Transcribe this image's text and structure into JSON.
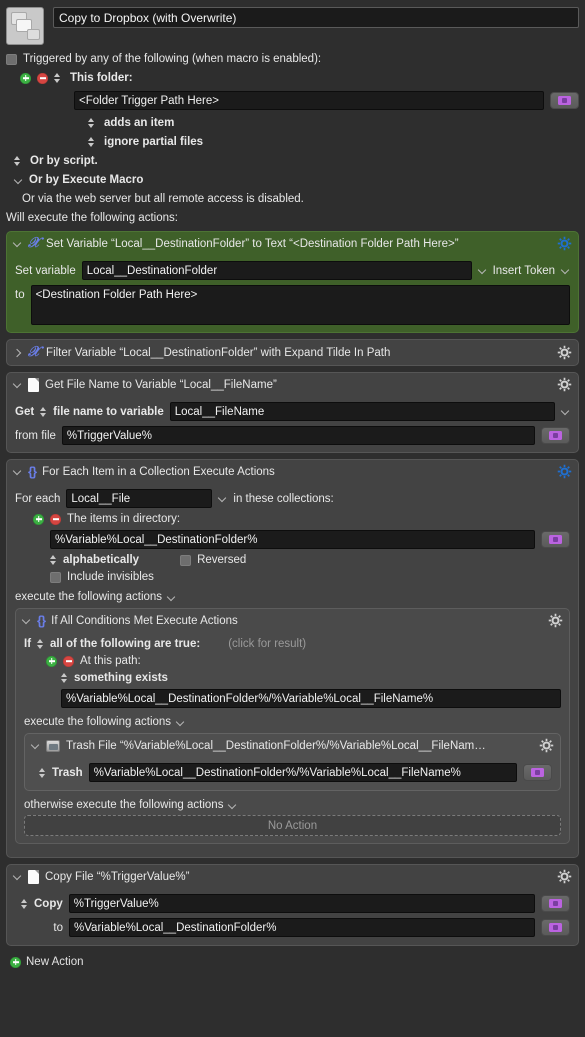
{
  "header": {
    "macro_icon": "copy-documents-icon",
    "macro_title": "Copy to Dropbox (with Overwrite)"
  },
  "triggers": {
    "enabled_label": "Triggered by any of the following (when macro is enabled):",
    "folder_trigger_label": "This folder:",
    "folder_path_value": "<Folder Trigger Path Here>",
    "folder_event": "adds an item",
    "folder_option": "ignore partial files",
    "or_by_script": "Or by script.",
    "or_by_execute_macro": "Or by Execute Macro",
    "web_server_note": "Or via the web server but all remote access is disabled.",
    "will_execute": "Will execute the following actions:"
  },
  "actions": {
    "set_variable": {
      "title": "Set Variable “Local__DestinationFolder” to Text “<Destination Folder Path Here>”",
      "set_label": "Set variable",
      "variable_value": "Local__DestinationFolder",
      "insert_token": "Insert Token",
      "to_label": "to",
      "to_value": "<Destination Folder Path Here>"
    },
    "filter_variable": {
      "title": "Filter Variable “Local__DestinationFolder” with Expand Tilde In Path"
    },
    "get_file_name": {
      "title": "Get File Name to Variable “Local__FileName”",
      "get_label": "Get",
      "get_kind": "file name to variable",
      "variable_value": "Local__FileName",
      "from_label": "from file",
      "from_value": "%TriggerValue%"
    },
    "for_each": {
      "title": "For Each Item in a Collection Execute Actions",
      "for_each_label": "For each",
      "for_each_variable": "Local__File",
      "in_collections_label": "in these collections:",
      "collection_label": "The items in directory:",
      "directory_value": "%Variable%Local__DestinationFolder%",
      "sort_order": "alphabetically",
      "reversed_label": "Reversed",
      "include_invisibles_label": "Include invisibles",
      "execute_label": "execute the following actions"
    },
    "if_conditions": {
      "title": "If All Conditions Met Execute Actions",
      "if_label": "If",
      "condition_mode": "all of the following are true:",
      "click_for_result": "(click for result)",
      "at_this_path_label": "At this path:",
      "exists_condition": "something exists",
      "path_value": "%Variable%Local__DestinationFolder%/%Variable%Local__FileName%",
      "execute_label": "execute the following actions",
      "otherwise_label": "otherwise execute the following actions",
      "no_action": "No Action"
    },
    "trash_file": {
      "title": "Trash File “%Variable%Local__DestinationFolder%/%Variable%Local__FileNam…",
      "trash_label": "Trash",
      "trash_value": "%Variable%Local__DestinationFolder%/%Variable%Local__FileName%"
    },
    "copy_file": {
      "title": "Copy File “%TriggerValue%”",
      "copy_label": "Copy",
      "copy_value": "%TriggerValue%",
      "to_label": "to",
      "to_value": "%Variable%Local__DestinationFolder%"
    }
  },
  "footer": {
    "new_action": "New Action"
  },
  "colors": {
    "page_background": "#2e2e2e",
    "card_background": "#434343",
    "set_variable_green": "#3f6029",
    "accent_blue": "#1f6fd0",
    "icon_blue": "#6a7ee8",
    "folder_purple": "#bb63e0",
    "add_green": "#3cb043",
    "remove_red": "#d64541"
  }
}
